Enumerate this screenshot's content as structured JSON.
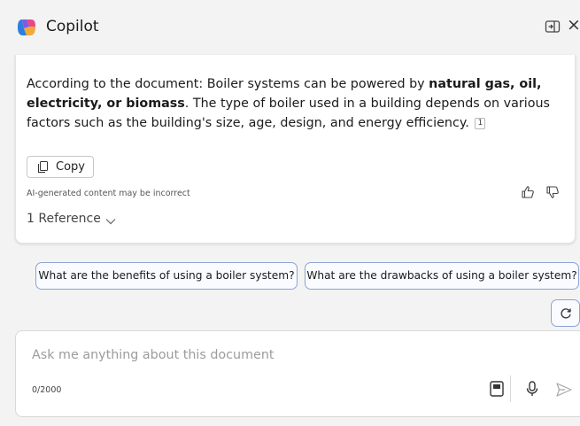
{
  "app": {
    "title": "Copilot"
  },
  "answer": {
    "text_before": "According to the document: Boiler systems can be powered by ",
    "bold_text": "natural gas, oil, electricity, or biomass",
    "text_after": ". The type of boiler used in a building depends on various factors such as the building's size, age, design, and energy efficiency.",
    "citation": "1"
  },
  "actions": {
    "copy_label": "Copy",
    "disclaimer": "AI-generated content may be incorrect",
    "reference_label": "1 Reference"
  },
  "suggestions": [
    "What are the benefits of using a boiler system?",
    "What are the drawbacks of using a boiler system?"
  ],
  "input": {
    "placeholder": "Ask me anything about this document",
    "counter": "0/2000"
  },
  "colors": {
    "suggestion_border": "#8da2d6",
    "background": "#f3f3f3"
  }
}
